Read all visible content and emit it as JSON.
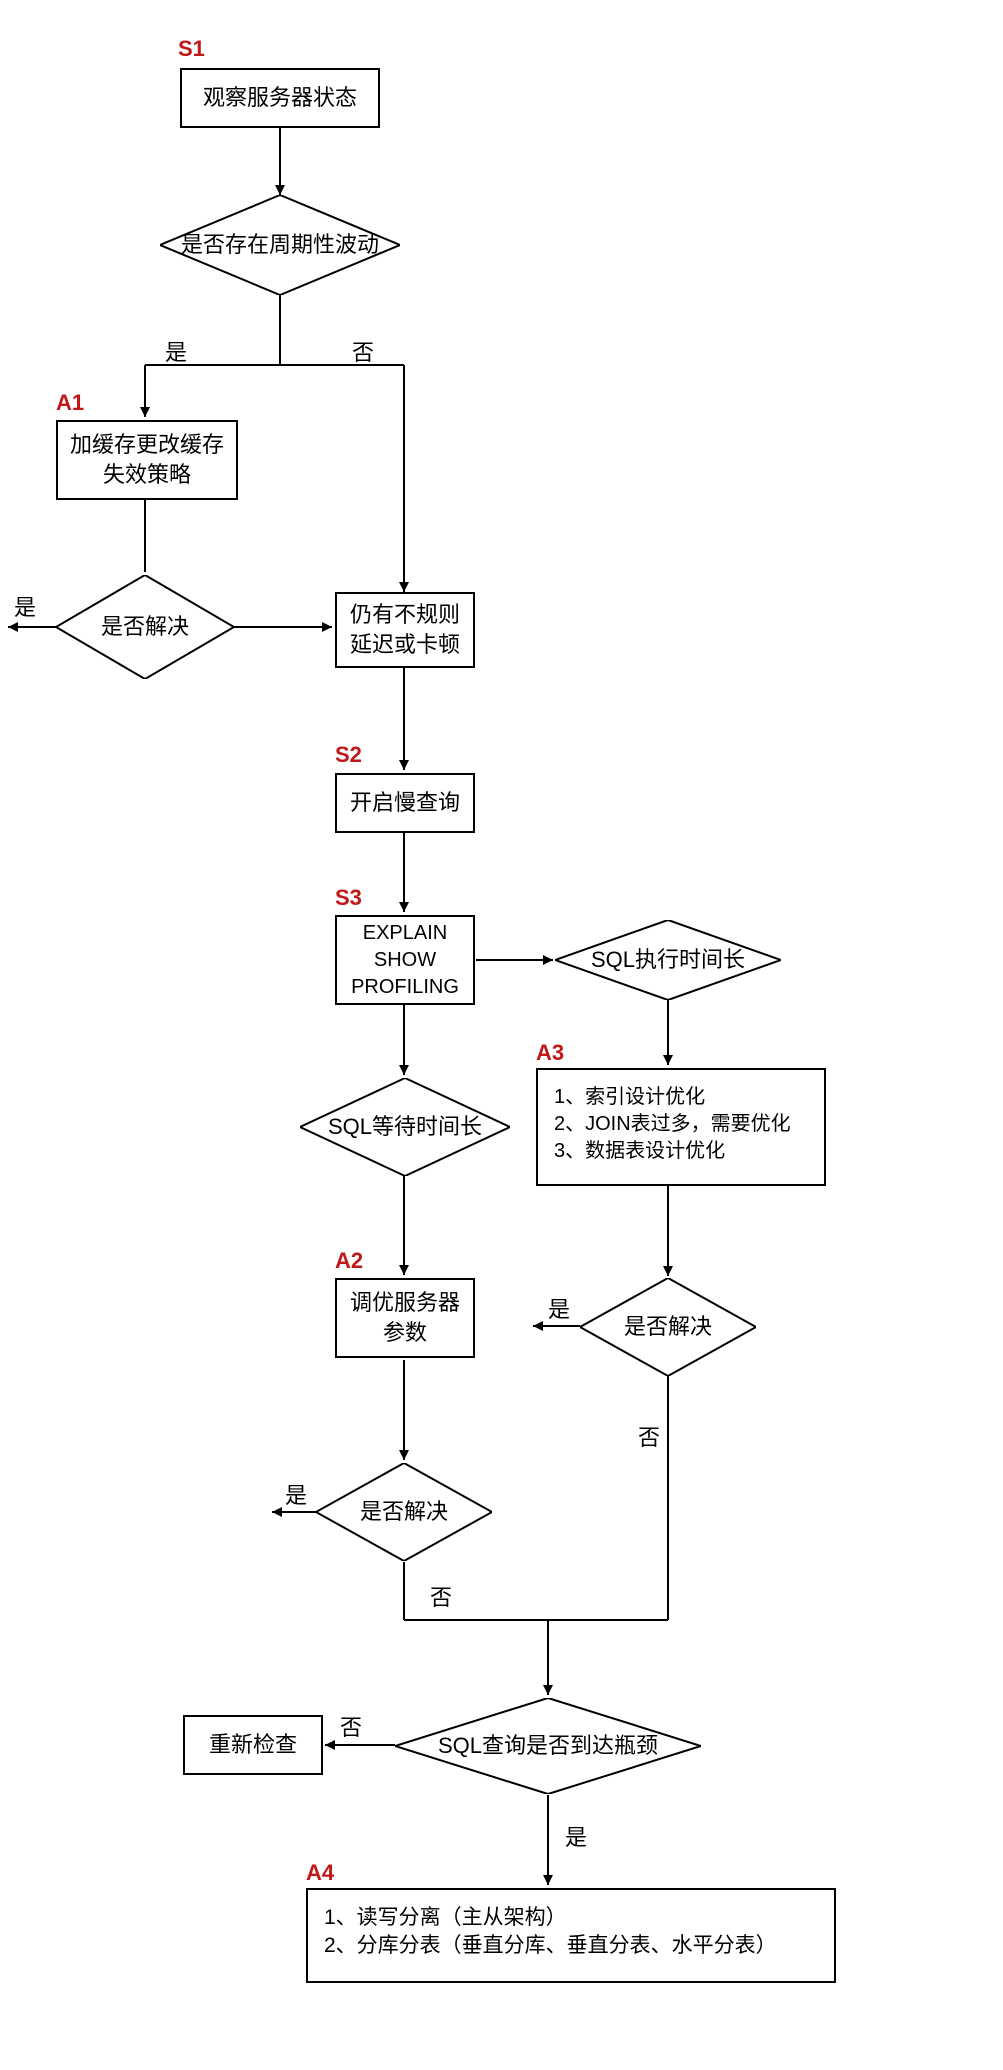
{
  "tags": {
    "s1": "S1",
    "s2": "S2",
    "s3": "S3",
    "a1": "A1",
    "a2": "A2",
    "a3": "A3",
    "a4": "A4"
  },
  "nodes": {
    "observe": "观察服务器状态",
    "periodic": "是否存在周期性波动",
    "cache": "加缓存更改缓存\n失效策略",
    "resolved1": "是否解决",
    "irregular": "仍有不规则\n延迟或卡顿",
    "slowquery": "开启慢查询",
    "explain": "EXPLAIN\nSHOW\nPROFILING",
    "sqllong": "SQL执行时间长",
    "a3list": "1、索引设计优化\n2、JOIN表过多，需要优化\n3、数据表设计优化",
    "resolved3": "是否解决",
    "waitlong": "SQL等待时间长",
    "tuneserver": "调优服务器\n参数",
    "resolved2": "是否解决",
    "bottleneck": "SQL查询是否到达瓶颈",
    "recheck": "重新检查",
    "a4list": "1、读写分离（主从架构）\n2、分库分表（垂直分库、垂直分表、水平分表）"
  },
  "labels": {
    "yes": "是",
    "no": "否"
  }
}
